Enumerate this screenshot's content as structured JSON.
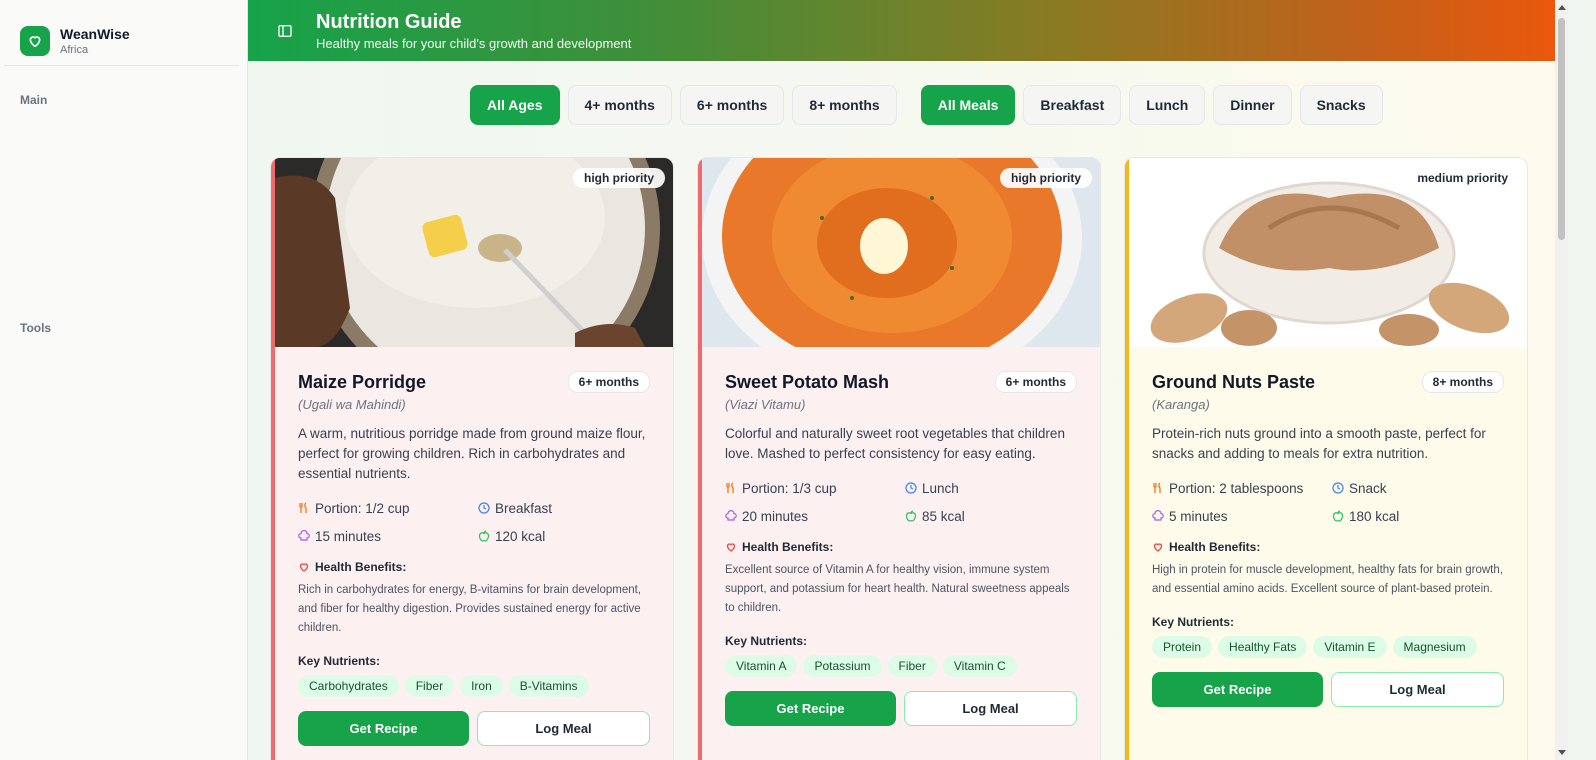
{
  "app": {
    "name": "WeanWise",
    "region": "Africa"
  },
  "sidebar": {
    "sections": [
      "Main",
      "Tools"
    ]
  },
  "header": {
    "title": "Nutrition Guide",
    "subtitle": "Healthy meals for your child's growth and development"
  },
  "filters": {
    "ages": [
      "All Ages",
      "4+ months",
      "6+ months",
      "8+ months"
    ],
    "meals": [
      "All Meals",
      "Breakfast",
      "Lunch",
      "Dinner",
      "Snacks"
    ],
    "active_age": "All Ages",
    "active_meal": "All Meals"
  },
  "labels": {
    "health_benefits": "Health Benefits:",
    "key_nutrients": "Key Nutrients:",
    "get_recipe": "Get Recipe",
    "log_meal": "Log Meal"
  },
  "colors": {
    "primary": "#16a34a",
    "high_priority": "#ef4444",
    "medium_priority": "#f5b814"
  },
  "cards": [
    {
      "priority": "high priority",
      "title": "Maize Porridge",
      "local_name": "(Ugali wa Mahindi)",
      "age": "6+ months",
      "description": "A warm, nutritious porridge made from ground maize flour, perfect for growing children. Rich in carbohydrates and essential nutrients.",
      "portion": "Portion: 1/2 cup",
      "meal": "Breakfast",
      "time": "15 minutes",
      "calories": "120 kcal",
      "benefits": "Rich in carbohydrates for energy, B-vitamins for brain development, and fiber for healthy digestion. Provides sustained energy for active children.",
      "nutrients": [
        "Carbohydrates",
        "Fiber",
        "Iron",
        "B-Vitamins"
      ]
    },
    {
      "priority": "high priority",
      "title": "Sweet Potato Mash",
      "local_name": "(Viazi Vitamu)",
      "age": "6+ months",
      "description": "Colorful and naturally sweet root vegetables that children love. Mashed to perfect consistency for easy eating.",
      "portion": "Portion: 1/3 cup",
      "meal": "Lunch",
      "time": "20 minutes",
      "calories": "85 kcal",
      "benefits": "Excellent source of Vitamin A for healthy vision, immune system support, and potassium for heart health. Natural sweetness appeals to children.",
      "nutrients": [
        "Vitamin A",
        "Potassium",
        "Fiber",
        "Vitamin C"
      ]
    },
    {
      "priority": "medium priority",
      "title": "Ground Nuts Paste",
      "local_name": "(Karanga)",
      "age": "8+ months",
      "description": "Protein-rich nuts ground into a smooth paste, perfect for snacks and adding to meals for extra nutrition.",
      "portion": "Portion: 2 tablespoons",
      "meal": "Snack",
      "time": "5 minutes",
      "calories": "180 kcal",
      "benefits": "High in protein for muscle development, healthy fats for brain growth, and essential amino acids. Excellent source of plant-based protein.",
      "nutrients": [
        "Protein",
        "Healthy Fats",
        "Vitamin E",
        "Magnesium"
      ]
    }
  ]
}
